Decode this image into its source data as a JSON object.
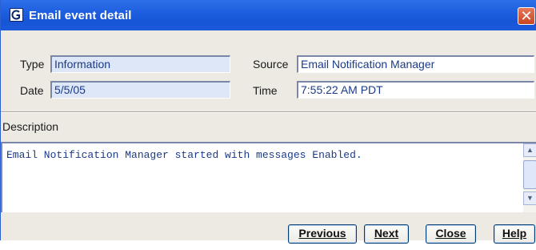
{
  "window": {
    "title": "Email event detail",
    "app_icon": "app-g-icon",
    "close_glyph": "✕"
  },
  "fields": {
    "type_label": "Type",
    "type_value": "Information",
    "source_label": "Source",
    "source_value": "Email Notification Manager",
    "date_label": "Date",
    "date_value": "5/5/05",
    "time_label": "Time",
    "time_value": "7:55:22 AM PDT"
  },
  "description": {
    "label": "Description",
    "text": "Email Notification Manager started with messages Enabled."
  },
  "buttons": {
    "previous": "Previous",
    "next": "Next",
    "close": "Close",
    "help": "Help"
  },
  "colors": {
    "titlebar": "#1d5fe0",
    "readonly_field_bg": "#dde7f8",
    "field_text": "#1a3a8a",
    "close_button": "#c9461f"
  }
}
